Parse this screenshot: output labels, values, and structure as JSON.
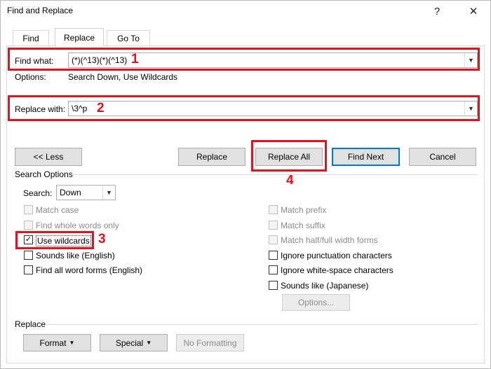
{
  "window": {
    "title": "Find and Replace",
    "help_label": "?",
    "close_label": "✕"
  },
  "tabs": [
    {
      "label": "Find"
    },
    {
      "label": "Replace",
      "active": true
    },
    {
      "label": "Go To"
    }
  ],
  "find": {
    "label": "Find what:",
    "value": "(*)(^13)(*)(^13)",
    "options_label": "Options:",
    "options_value": "Search Down, Use Wildcards"
  },
  "replace": {
    "label": "Replace with:",
    "value": "\\3^p"
  },
  "buttons": {
    "less": "<< Less",
    "replace": "Replace",
    "replace_all": "Replace All",
    "find_next": "Find Next",
    "cancel": "Cancel"
  },
  "search_options": {
    "heading": "Search Options",
    "search_label": "Search:",
    "search_value": "Down",
    "left_checks": [
      {
        "label": "Match case",
        "checked": false,
        "enabled": false
      },
      {
        "label": "Find whole words only",
        "checked": false,
        "enabled": false
      },
      {
        "label": "Use wildcards",
        "checked": true,
        "enabled": true
      },
      {
        "label": "Sounds like (English)",
        "checked": false,
        "enabled": true
      },
      {
        "label": "Find all word forms (English)",
        "checked": false,
        "enabled": true
      }
    ],
    "right_checks": [
      {
        "label": "Match prefix",
        "checked": false,
        "enabled": false
      },
      {
        "label": "Match suffix",
        "checked": false,
        "enabled": false
      },
      {
        "label": "Match half/full width forms",
        "checked": false,
        "enabled": false
      },
      {
        "label": "Ignore punctuation characters",
        "checked": false,
        "enabled": true
      },
      {
        "label": "Ignore white-space characters",
        "checked": false,
        "enabled": true
      },
      {
        "label": "Sounds like (Japanese)",
        "checked": false,
        "enabled": true
      }
    ],
    "options_button": "Options..."
  },
  "replace_section": {
    "heading": "Replace",
    "format_button": "Format",
    "special_button": "Special",
    "no_formatting_button": "No Formatting"
  },
  "annotations": [
    "1",
    "2",
    "3",
    "4"
  ],
  "colors": {
    "annotation_red": "#e8101e",
    "default_button_border": "#0078d7",
    "button_face": "#e1e1e1"
  }
}
